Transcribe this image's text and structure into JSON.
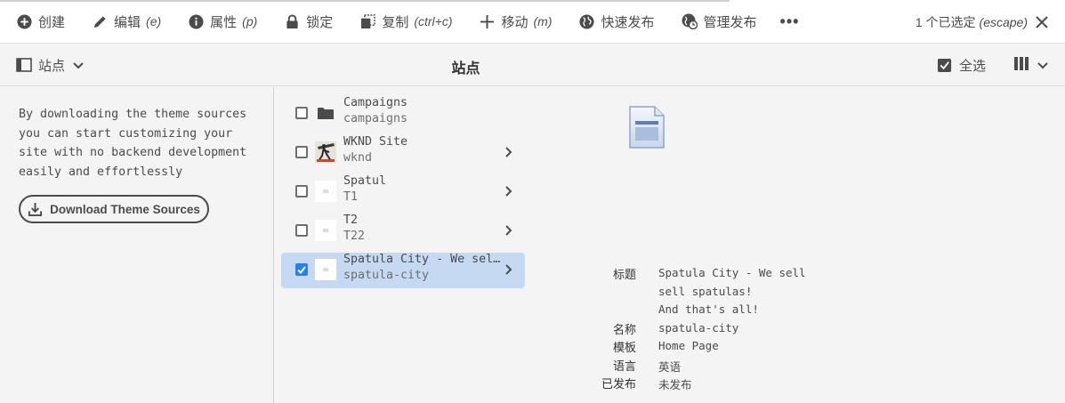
{
  "actionbar": {
    "create": "创建",
    "edit": "编辑",
    "edit_shortcut": "(e)",
    "properties": "属性",
    "properties_shortcut": "(p)",
    "lock": "锁定",
    "copy": "复制",
    "copy_shortcut": "(ctrl+c)",
    "move": "移动",
    "move_shortcut": "(m)",
    "quick_publish": "快速发布",
    "manage_publication": "管理发布",
    "more": "•••",
    "selection": "1 个已选定",
    "selection_shortcut": "(escape)"
  },
  "secondary": {
    "rail_toggle": "站点",
    "title": "站点",
    "select_all": "全选"
  },
  "rail": {
    "description": "By downloading the theme sources you can start customizing your site with no backend development easily and effortlessly",
    "download_button": "Download Theme Sources"
  },
  "items": [
    {
      "title": "Campaigns",
      "name": "campaigns",
      "type": "folder",
      "selected": false,
      "has_children": false
    },
    {
      "title": "WKND Site",
      "name": "wknd",
      "type": "image",
      "selected": false,
      "has_children": true
    },
    {
      "title": "Spatul",
      "name": "T1",
      "type": "page",
      "selected": false,
      "has_children": true
    },
    {
      "title": "T2",
      "name": "T22",
      "type": "page",
      "selected": false,
      "has_children": true
    },
    {
      "title": "Spatula City - We sell…",
      "name": "spatula-city",
      "type": "page",
      "selected": true,
      "has_children": true
    }
  ],
  "meta": {
    "title_label": "标题",
    "title_lines": [
      "Spatula City - We sell",
      "sell spatulas!",
      "And that's all!"
    ],
    "name_label": "名称",
    "name_value": "spatula-city",
    "template_label": "模板",
    "template_value": "Home Page",
    "language_label": "语言",
    "language_value": "英语",
    "published_label": "已发布",
    "published_value": "未发布"
  },
  "colors": {
    "accent": "#2680eb",
    "selected_row": "#c6d9f3",
    "text": "#4b4b4b"
  }
}
